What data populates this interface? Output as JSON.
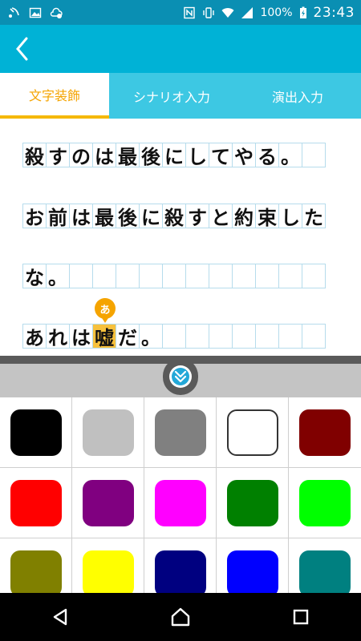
{
  "status_bar": {
    "battery": "100%",
    "time": "23:43",
    "icons": [
      "wifi-calling-icon",
      "image-icon",
      "cloud-sync-icon",
      "nfc-icon",
      "vibrate-icon",
      "wifi-icon",
      "signal-icon",
      "battery-charging-icon"
    ]
  },
  "app_bar": {
    "back_icon": "chevron-left-icon"
  },
  "tabs": [
    {
      "label": "文字装飾",
      "active": true
    },
    {
      "label": "シナリオ入力",
      "active": false
    },
    {
      "label": "演出入力",
      "active": false
    }
  ],
  "editor": {
    "lines": [
      {
        "text": "殺すのは最後にしてやる。"
      },
      {
        "text": "お前は最後に殺すと約束した"
      },
      {
        "text": "な。"
      },
      {
        "text": "あれは嘘だ。"
      }
    ],
    "ruby_label": "あ",
    "highlight_char": "嘘"
  },
  "palette": {
    "collapse_icon": "double-chevron-down-icon",
    "colors": [
      "#000000",
      "#c0c0c0",
      "#808080",
      "#ffffff",
      "#800000",
      "#ff0000",
      "#800080",
      "#ff00ff",
      "#008000",
      "#00ff00",
      "#808000",
      "#ffff00",
      "#000080",
      "#0000ff",
      "#008080"
    ]
  },
  "nav_bar": {
    "icons": [
      "back-triangle-icon",
      "home-icon",
      "recents-square-icon"
    ]
  }
}
